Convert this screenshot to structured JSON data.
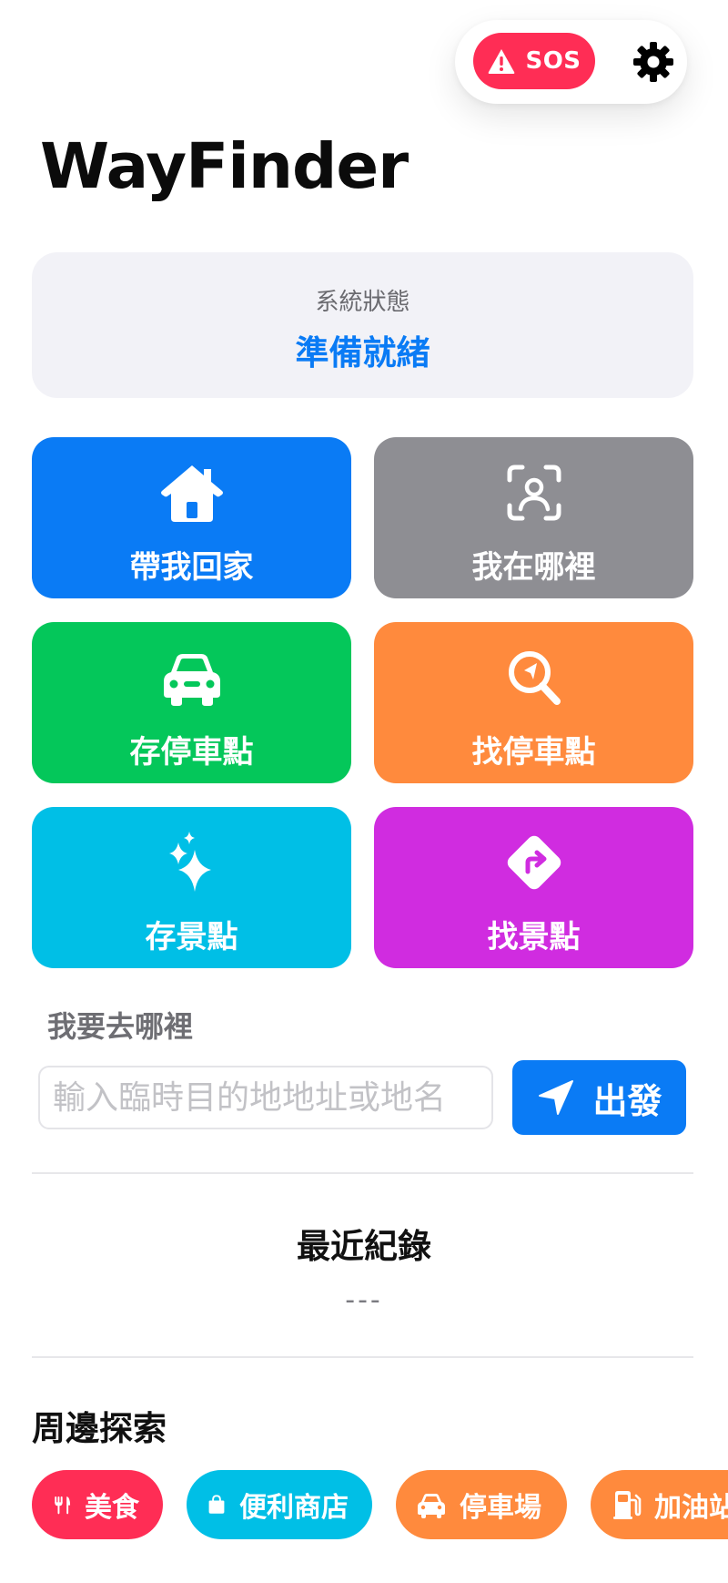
{
  "header": {
    "sos_label": "SOS",
    "sos_color": "#ff2d55",
    "settings_icon": "gear-icon"
  },
  "app": {
    "title": "WayFinder"
  },
  "status": {
    "label": "系統狀態",
    "value": "準備就緒",
    "value_color": "#0a7bf5"
  },
  "actions": [
    {
      "label": "帶我回家",
      "icon": "house-icon",
      "color": "#0a7bf5"
    },
    {
      "label": "我在哪裡",
      "icon": "face-scan-icon",
      "color": "#8e8e93"
    },
    {
      "label": "存停車點",
      "icon": "car-icon",
      "color": "#04c75a"
    },
    {
      "label": "找停車點",
      "icon": "search-location-icon",
      "color": "#ff8a3d"
    },
    {
      "label": "存景點",
      "icon": "sparkles-icon",
      "color": "#00bfe6"
    },
    {
      "label": "找景點",
      "icon": "turn-sign-icon",
      "color": "#d02ce0"
    }
  ],
  "destination": {
    "label": "我要去哪裡",
    "placeholder": "輸入臨時目的地地址或地名",
    "value": "",
    "go_label": "出發",
    "go_icon": "location-arrow-icon"
  },
  "recent": {
    "title": "最近紀錄",
    "value": "---"
  },
  "explore": {
    "title": "周邊探索",
    "chips": [
      {
        "label": "美食",
        "icon": "fork-knife-icon",
        "color": "#ff2d55"
      },
      {
        "label": "便利商店",
        "icon": "shopping-bag-icon",
        "color": "#00bfe6"
      },
      {
        "label": "停車場",
        "icon": "car-icon",
        "color": "#ff8a3d"
      },
      {
        "label": "加油站",
        "icon": "fuel-pump-icon",
        "color": "#ff8a3d"
      }
    ]
  }
}
